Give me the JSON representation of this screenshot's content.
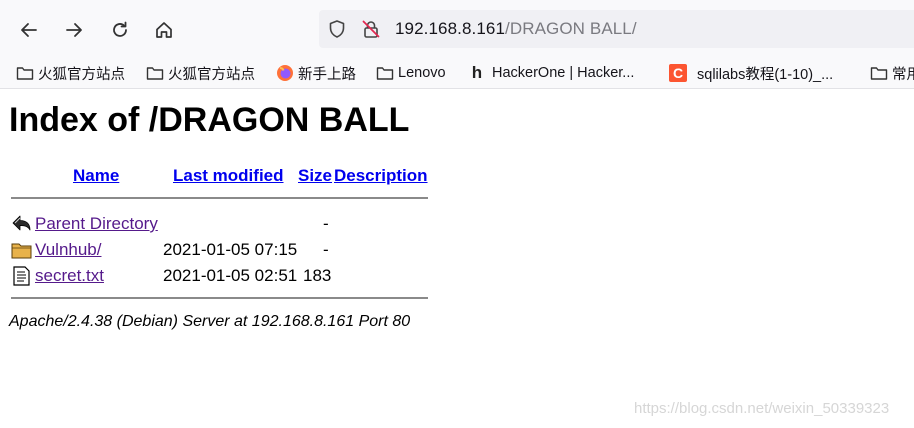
{
  "browser": {
    "address": {
      "host": "192.168.8.161",
      "path": "/DRAGON BALL/"
    },
    "bookmarks": [
      {
        "label": "火狐官方站点",
        "icon": "folder-icon"
      },
      {
        "label": "火狐官方站点",
        "icon": "folder-icon"
      },
      {
        "label": "新手上路",
        "icon": "firefox-icon"
      },
      {
        "label": "Lenovo",
        "icon": "folder-icon"
      },
      {
        "label": "HackerOne | Hacker...",
        "icon": "hackerone-icon"
      },
      {
        "label": "sqlilabs教程(1-10)_...",
        "icon": "csdn-icon"
      },
      {
        "label": "常用",
        "icon": "folder-icon"
      }
    ]
  },
  "page": {
    "title": "Index of /DRAGON BALL",
    "columns": {
      "name": "Name",
      "modified": "Last modified",
      "size": "Size",
      "description": "Description"
    },
    "rows": [
      {
        "icon": "back-arrow-icon",
        "name": "Parent Directory",
        "modified": "",
        "size": "-"
      },
      {
        "icon": "folder-icon",
        "name": "Vulnhub/",
        "modified": "2021-01-05 07:15",
        "size": "-"
      },
      {
        "icon": "text-file-icon",
        "name": "secret.txt",
        "modified": "2021-01-05 02:51",
        "size": "183"
      }
    ],
    "footer": "Apache/2.4.38 (Debian) Server at 192.168.8.161 Port 80"
  },
  "watermark": "https://blog.csdn.net/weixin_50339323",
  "colors": {
    "link": "#0000ee",
    "visited": "#551a8b",
    "chrome_bg": "#f9f9fb",
    "urlbar_bg": "#f0f0f4"
  }
}
